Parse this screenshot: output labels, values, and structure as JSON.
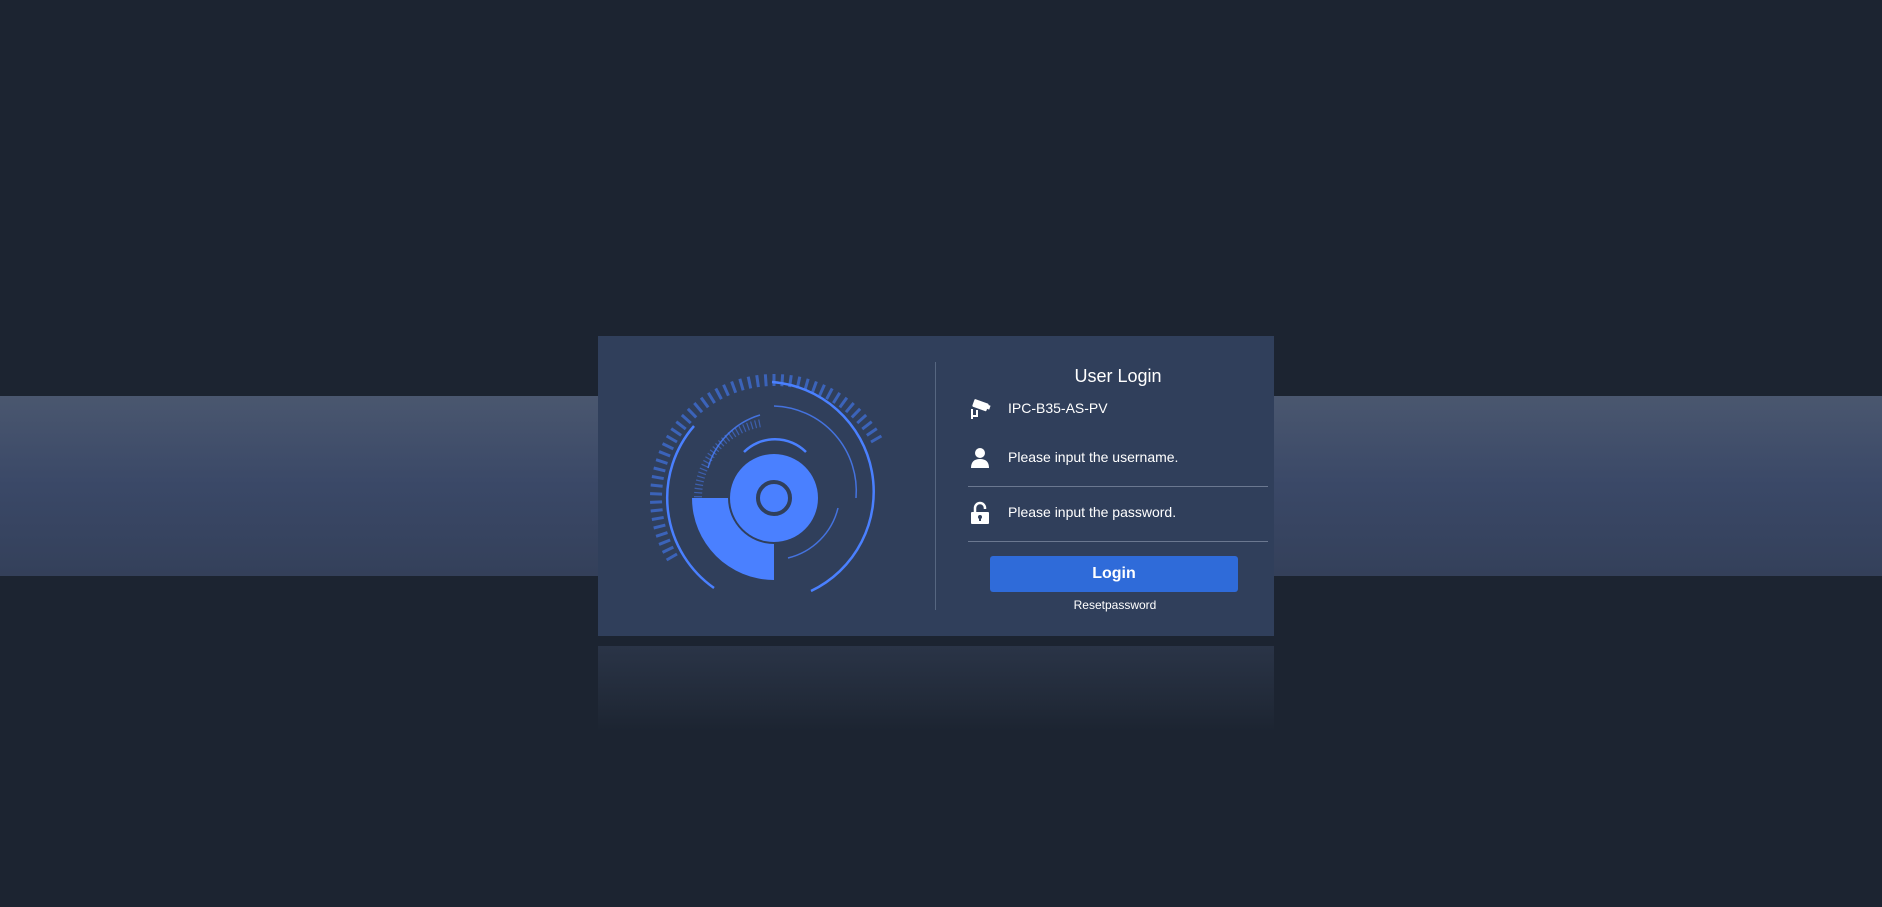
{
  "login": {
    "title": "User Login",
    "device_name": "IPC-B35-AS-PV",
    "username_placeholder": "Please input the username.",
    "password_placeholder": "Please input the password.",
    "login_label": "Login",
    "reset_label": "Resetpassword"
  },
  "colors": {
    "background": "#1c2431",
    "card": "#303f5b",
    "accent": "#4a80ff",
    "button": "#2f6bd9"
  },
  "icons": {
    "device": "camera-icon",
    "username": "user-icon",
    "password": "lock-icon"
  }
}
